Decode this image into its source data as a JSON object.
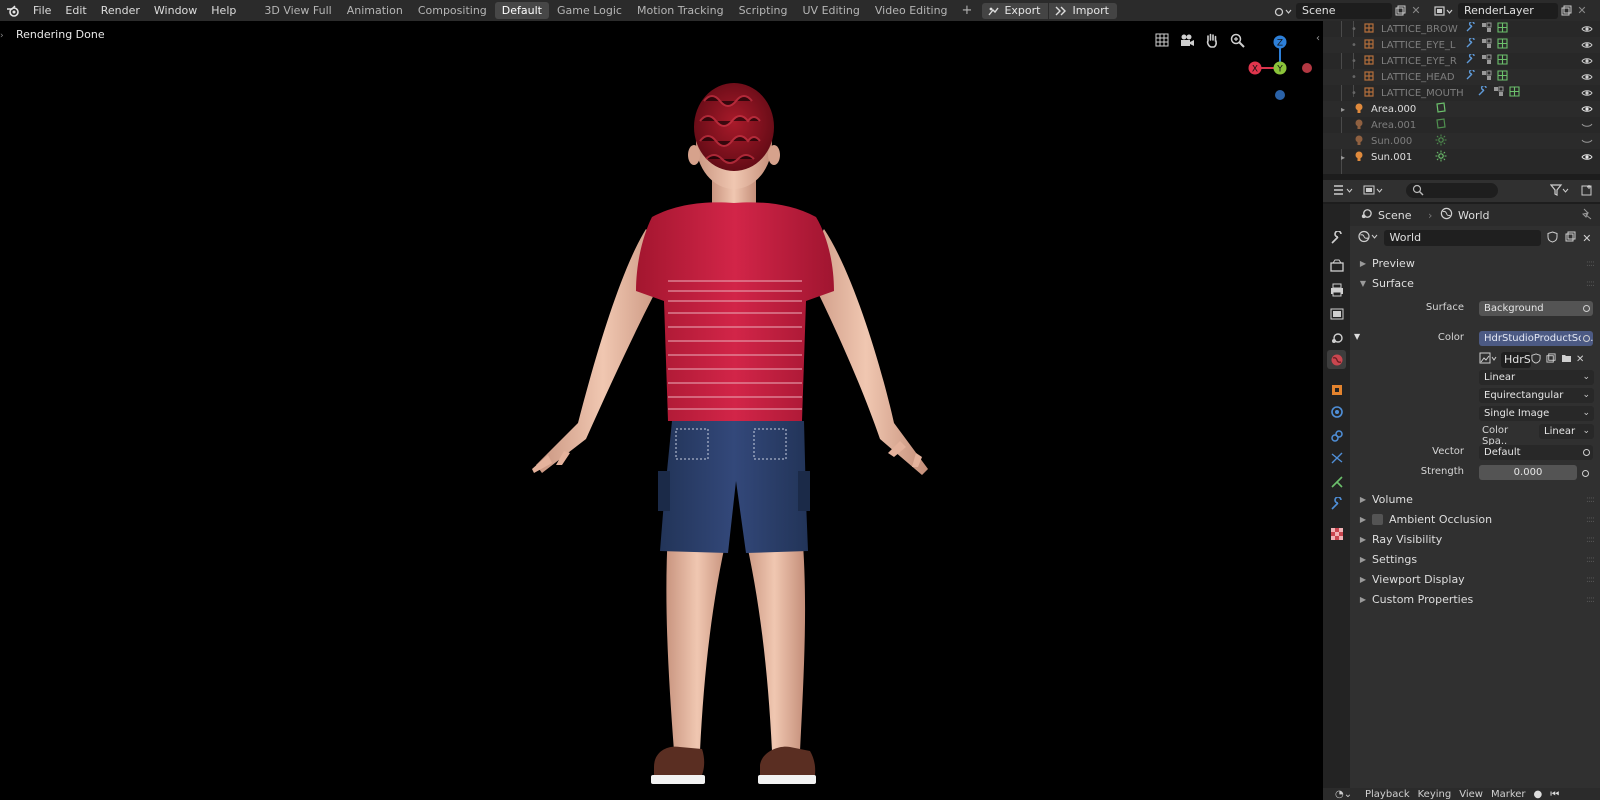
{
  "topbar": {
    "menu": [
      "File",
      "Edit",
      "Render",
      "Window",
      "Help"
    ],
    "workspaces": [
      {
        "label": "3D View Full",
        "active": false
      },
      {
        "label": "Animation",
        "active": false
      },
      {
        "label": "Compositing",
        "active": false
      },
      {
        "label": "Default",
        "active": true
      },
      {
        "label": "Game Logic",
        "active": false
      },
      {
        "label": "Motion Tracking",
        "active": false
      },
      {
        "label": "Scripting",
        "active": false
      },
      {
        "label": "UV Editing",
        "active": false
      },
      {
        "label": "Video Editing",
        "active": false
      }
    ],
    "add_workspace": "+",
    "export_label": "Export",
    "import_label": "Import",
    "scene_name": "Scene",
    "view_layer": "RenderLayer"
  },
  "viewport": {
    "status": "Rendering Done",
    "gizmo": {
      "z": "Z",
      "y": "Y",
      "x": "X"
    }
  },
  "outliner": {
    "rows": [
      {
        "name": "LATTICE_BROW",
        "visible": false,
        "type": "lattice"
      },
      {
        "name": "LATTICE_EYE_L",
        "visible": false,
        "type": "lattice"
      },
      {
        "name": "LATTICE_EYE_R",
        "visible": false,
        "type": "lattice"
      },
      {
        "name": "LATTICE_HEAD",
        "visible": false,
        "type": "lattice"
      },
      {
        "name": "LATTICE_MOUTH",
        "visible": false,
        "type": "lattice"
      },
      {
        "name": "Area.000",
        "visible": true,
        "type": "light"
      },
      {
        "name": "Area.001",
        "visible": false,
        "type": "light"
      },
      {
        "name": "Sun.000",
        "visible": false,
        "type": "light"
      },
      {
        "name": "Sun.001",
        "visible": true,
        "type": "light"
      }
    ]
  },
  "properties": {
    "breadcrumb_scene": "Scene",
    "breadcrumb_world": "World",
    "world_name": "World",
    "panels": {
      "preview": "Preview",
      "surface": "Surface",
      "volume": "Volume",
      "ambient_occlusion": "Ambient Occlusion",
      "ray_visibility": "Ray Visibility",
      "settings": "Settings",
      "viewport_display": "Viewport Display",
      "custom_properties": "Custom Properties"
    },
    "surface": {
      "surface_label": "Surface",
      "surface_value": "Background",
      "color_label": "Color",
      "color_value": "HdrStudioProductSof...",
      "image_name": "HdrS",
      "interpolation": "Linear",
      "projection": "Equirectangular",
      "source": "Single Image",
      "colorspace_label": "Color Spa..",
      "colorspace_value": "Linear",
      "vector_label": "Vector",
      "vector_value": "Default",
      "strength_label": "Strength",
      "strength_value": "0.000"
    }
  },
  "timeline": {
    "playback": "Playback",
    "keying": "Keying",
    "view": "View",
    "marker": "Marker"
  },
  "colors": {
    "accent_field": "#4c5a84",
    "active_tab": "#474747",
    "shirt": "#c21f3e",
    "shorts": "#2e4372",
    "skin": "#e8b89f"
  }
}
